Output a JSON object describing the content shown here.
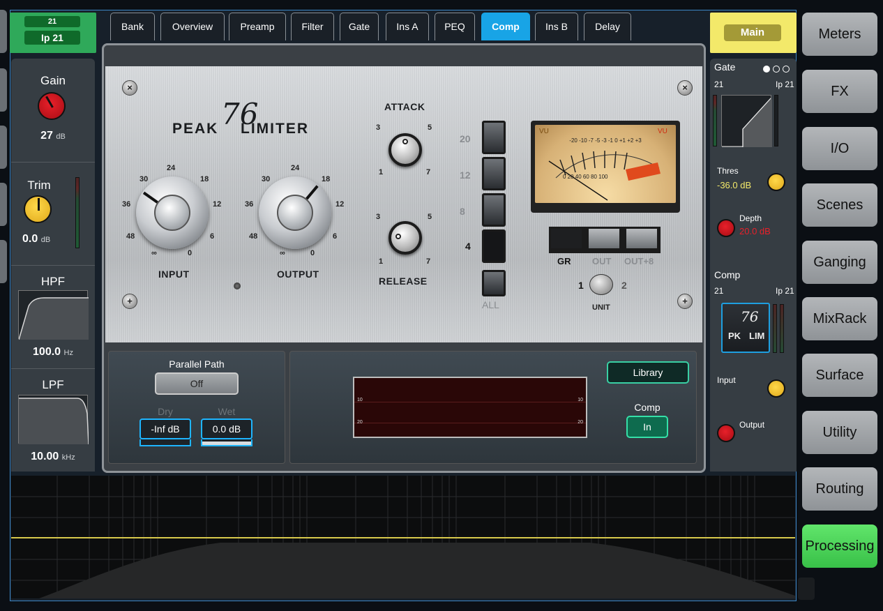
{
  "channel": {
    "number": "21",
    "name": "Ip 21"
  },
  "left_strip": {
    "gain": {
      "label": "Gain",
      "value": "27",
      "unit": "dB"
    },
    "trim": {
      "label": "Trim",
      "value": "0.0",
      "unit": "dB"
    },
    "hpf": {
      "label": "HPF",
      "value": "100.0",
      "unit": "Hz"
    },
    "lpf": {
      "label": "LPF",
      "value": "10.00",
      "unit": "kHz"
    }
  },
  "tabs": [
    {
      "label": "Bank"
    },
    {
      "label": "Overview"
    },
    {
      "label": "Preamp"
    },
    {
      "label": "Filter"
    },
    {
      "label": "Gate"
    },
    {
      "label": "Ins A"
    },
    {
      "label": "PEQ"
    },
    {
      "label": "Comp",
      "active": true
    },
    {
      "label": "Ins B"
    },
    {
      "label": "Delay"
    }
  ],
  "plugin": {
    "logo_text_left": "PEAK",
    "logo_text_right": "LIMITER",
    "logo_number": "76",
    "input_label": "INPUT",
    "output_label": "OUTPUT",
    "attack_label": "ATTACK",
    "release_label": "RELEASE",
    "big_scale": {
      "s30": "30",
      "s24": "24",
      "s18": "18",
      "s36": "36",
      "s12": "12",
      "s48": "48",
      "s6": "6",
      "sinf": "∞",
      "s0": "0"
    },
    "small_scale": {
      "s3": "3",
      "s5": "5",
      "s1": "1",
      "s7": "7"
    },
    "ratios": [
      "20",
      "12",
      "8",
      "4"
    ],
    "all_label": "ALL",
    "vu": {
      "label_left": "VU",
      "label_right": "VU",
      "scale_top": "-20 -10 -7 -5 -3 -1 0 +1 +2 +3",
      "scale_bottom": "0 20 40 60 80 100"
    },
    "meter_buttons": [
      "GR",
      "OUT",
      "OUT+8"
    ],
    "unit_label": "UNIT",
    "unit_1": "1",
    "unit_2": "2"
  },
  "lower": {
    "parallel_path_label": "Parallel Path",
    "parallel_path_value": "Off",
    "dry_label": "Dry",
    "dry_value": "-Inf dB",
    "wet_label": "Wet",
    "wet_value": "0.0 dB",
    "library_label": "Library",
    "comp_label": "Comp",
    "comp_value": "In",
    "gr_scale": {
      "l10": "10",
      "l20": "20",
      "r10": "10",
      "r20": "20"
    }
  },
  "right_strip": {
    "header": "Main",
    "gate": {
      "title": "Gate",
      "ch": "21",
      "name": "Ip 21",
      "thres_label": "Thres",
      "thres_value": "-36.0 dB",
      "depth_label": "Depth",
      "depth_value": "20.0 dB"
    },
    "comp": {
      "title": "Comp",
      "ch": "21",
      "name": "Ip 21",
      "thumb_top": "76",
      "thumb_left": "PK",
      "thumb_right": "LIM",
      "input_label": "Input",
      "output_label": "Output"
    }
  },
  "menu": [
    {
      "label": "Meters"
    },
    {
      "label": "FX"
    },
    {
      "label": "I/O"
    },
    {
      "label": "Scenes"
    },
    {
      "label": "Ganging"
    },
    {
      "label": "MixRack"
    },
    {
      "label": "Surface"
    },
    {
      "label": "Utility"
    },
    {
      "label": "Routing"
    },
    {
      "label": "Processing",
      "active": true
    }
  ],
  "colors": {
    "accent_blue": "#18a4e6",
    "active_green": "#3fd14e",
    "main_yellow": "#f3e96a",
    "gain_red": "#e8202a",
    "knob_yellow": "#ffd84a"
  }
}
